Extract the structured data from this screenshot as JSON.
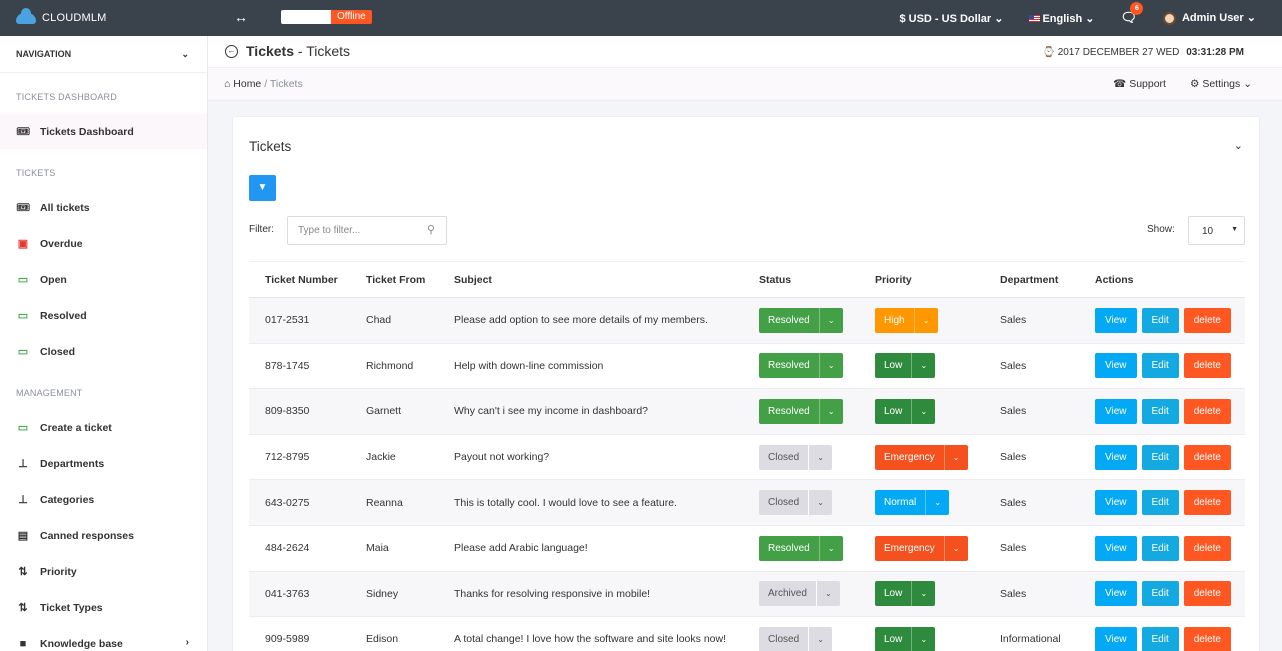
{
  "topbar": {
    "brand": "CLOUDMLM",
    "status": "Offline",
    "currency": "$ USD - US Dollar",
    "language": "English",
    "notifications": "6",
    "user": "Admin User"
  },
  "header": {
    "title_bold": "Tickets",
    "title_rest": " - Tickets",
    "date": "2017 DECEMBER 27  WED",
    "time": "03:31:28 PM"
  },
  "breadcrumb": {
    "home": "Home",
    "sep": "/",
    "current": "Tickets",
    "support": "Support",
    "settings": "Settings"
  },
  "sidebar": {
    "nav_label": "NAVIGATION",
    "sections": {
      "dashboard": "TICKETS DASHBOARD",
      "tickets": "TICKETS",
      "management": "MANAGEMENT"
    },
    "items": {
      "dashboard": "Tickets Dashboard",
      "all": "All tickets",
      "overdue": "Overdue",
      "open": "Open",
      "resolved": "Resolved",
      "closed": "Closed",
      "create": "Create a ticket",
      "departments": "Departments",
      "categories": "Categories",
      "canned": "Canned responses",
      "priority": "Priority",
      "types": "Ticket Types",
      "kb": "Knowledge base"
    }
  },
  "panel": {
    "title": "Tickets",
    "filter_label": "Filter:",
    "filter_placeholder": "Type to filter...",
    "show_label": "Show:",
    "show_value": "10"
  },
  "table": {
    "headers": [
      "Ticket Number",
      "Ticket From",
      "Subject",
      "Status",
      "Priority",
      "Department",
      "Actions"
    ],
    "actions": {
      "view": "View",
      "edit": "Edit",
      "delete": "delete"
    },
    "rows": [
      {
        "number": "017-2531",
        "from": "Chad",
        "subject": "Please add option to see more details of my members.",
        "status": "Resolved",
        "priority": "High",
        "department": "Sales"
      },
      {
        "number": "878-1745",
        "from": "Richmond",
        "subject": "Help with down-line commission",
        "status": "Resolved",
        "priority": "Low",
        "department": "Sales"
      },
      {
        "number": "809-8350",
        "from": "Garnett",
        "subject": "Why can't i see my income in dashboard?",
        "status": "Resolved",
        "priority": "Low",
        "department": "Sales"
      },
      {
        "number": "712-8795",
        "from": "Jackie",
        "subject": "Payout not working?",
        "status": "Closed",
        "priority": "Emergency",
        "department": "Sales"
      },
      {
        "number": "643-0275",
        "from": "Reanna",
        "subject": "This is totally cool. I would love to see a feature.",
        "status": "Closed",
        "priority": "Normal",
        "department": "Sales"
      },
      {
        "number": "484-2624",
        "from": "Maia",
        "subject": "Please add Arabic language!",
        "status": "Resolved",
        "priority": "Emergency",
        "department": "Sales"
      },
      {
        "number": "041-3763",
        "from": "Sidney",
        "subject": "Thanks for resolving responsive in mobile!",
        "status": "Archived",
        "priority": "Low",
        "department": "Sales"
      },
      {
        "number": "909-5989",
        "from": "Edison",
        "subject": "A total change! I love how the software and site looks now!",
        "status": "Closed",
        "priority": "Low",
        "department": "Informational"
      }
    ]
  },
  "colors": {
    "Resolved": "#43a047",
    "Closed": "#dcdce2",
    "Archived": "#dcdce2",
    "High": "#ff9800",
    "Low": "#2e8b3e",
    "Emergency": "#f4511e",
    "Normal": "#03a9f4"
  }
}
